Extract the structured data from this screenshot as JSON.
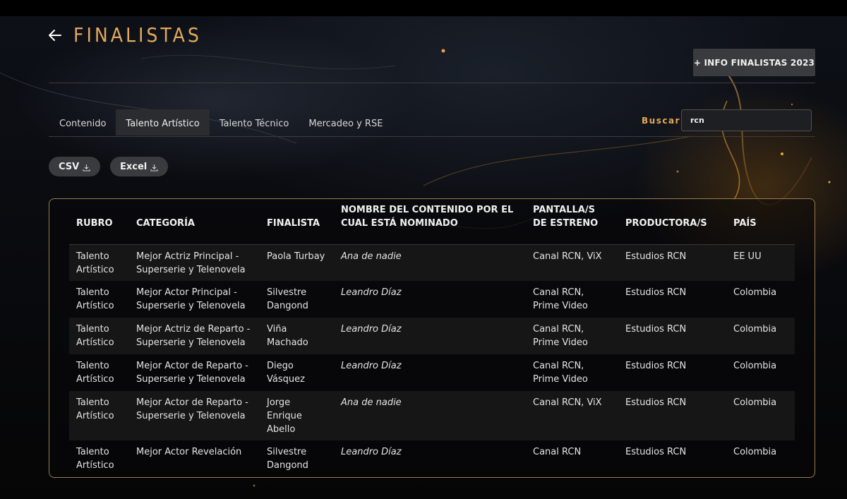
{
  "header": {
    "title": "FINALISTAS",
    "info_button": "+ INFO FINALISTAS 2023"
  },
  "tabs": [
    {
      "label": "Contenido",
      "active": false
    },
    {
      "label": "Talento Artístico",
      "active": true
    },
    {
      "label": "Talento Técnico",
      "active": false
    },
    {
      "label": "Mercadeo y RSE",
      "active": false
    }
  ],
  "search": {
    "label": "Buscar:",
    "value": "rcn"
  },
  "export": {
    "csv": "CSV",
    "excel": "Excel"
  },
  "table": {
    "headers": {
      "rubro": "RUBRO",
      "categoria": "CATEGORÍA",
      "finalista": "FINALISTA",
      "nombre": "NOMBRE DEL CONTENIDO POR EL CUAL ESTÁ NOMINADO",
      "pantalla": "PANTALLA/S DE ESTRENO",
      "productora": "PRODUCTORA/S",
      "pais": "PAÍS"
    },
    "rows": [
      {
        "rubro": "Talento Artístico",
        "categoria": "Mejor Actriz Principal - Superserie y Telenovela",
        "finalista": "Paola Turbay",
        "nombre": "Ana de nadie",
        "pantalla": "Canal RCN, ViX",
        "productora": "Estudios RCN",
        "pais": "EE UU"
      },
      {
        "rubro": "Talento Artístico",
        "categoria": "Mejor Actor Principal - Superserie y Telenovela",
        "finalista": "Silvestre Dangond",
        "nombre": "Leandro Díaz",
        "pantalla": "Canal RCN, Prime Video",
        "productora": "Estudios RCN",
        "pais": "Colombia"
      },
      {
        "rubro": "Talento Artístico",
        "categoria": "Mejor Actriz de Reparto - Superserie y Telenovela",
        "finalista": "Viña Machado",
        "nombre": "Leandro Díaz",
        "pantalla": "Canal RCN, Prime Video",
        "productora": "Estudios RCN",
        "pais": "Colombia"
      },
      {
        "rubro": "Talento Artístico",
        "categoria": "Mejor Actor de Reparto - Superserie y Telenovela",
        "finalista": "Diego Vásquez",
        "nombre": "Leandro Díaz",
        "pantalla": "Canal RCN, Prime Video",
        "productora": "Estudios RCN",
        "pais": "Colombia"
      },
      {
        "rubro": "Talento Artístico",
        "categoria": "Mejor Actor de Reparto - Superserie y Telenovela",
        "finalista": "Jorge Enrique Abello",
        "nombre": "Ana de nadie",
        "pantalla": "Canal RCN, ViX",
        "productora": "Estudios RCN",
        "pais": "Colombia"
      },
      {
        "rubro": "Talento Artístico",
        "categoria": "Mejor Actor Revelación",
        "finalista": "Silvestre Dangond",
        "nombre": "Leandro Díaz",
        "pantalla": "Canal RCN",
        "productora": "Estudios RCN",
        "pais": "Colombia"
      }
    ]
  },
  "colors": {
    "accent": "#e3a95c",
    "button_bg": "#3a3b3e",
    "table_border": "#9a7a4f"
  }
}
